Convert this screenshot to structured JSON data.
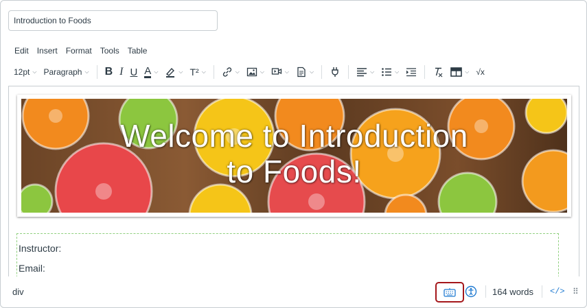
{
  "title_input": {
    "value": "Introduction to Foods"
  },
  "menubar": [
    "Edit",
    "Insert",
    "Format",
    "Tools",
    "Table"
  ],
  "toolbar": {
    "font_size": "12pt",
    "block_format": "Paragraph",
    "bold": "B",
    "italic": "I",
    "underline": "U",
    "text_color": "A",
    "superscript": "T²",
    "math": "√x"
  },
  "banner": {
    "title": "Welcome to Introduction\nto Foods!"
  },
  "content": {
    "instructor_label": "Instructor:",
    "email_label": "Email:"
  },
  "statusbar": {
    "element_path": "div",
    "word_count": "164 words",
    "html_toggle": "</>"
  },
  "colors": {
    "accent_blue": "#1f7ad1",
    "highlight_red": "#a4161a",
    "dashed_border": "#8fd07e"
  }
}
